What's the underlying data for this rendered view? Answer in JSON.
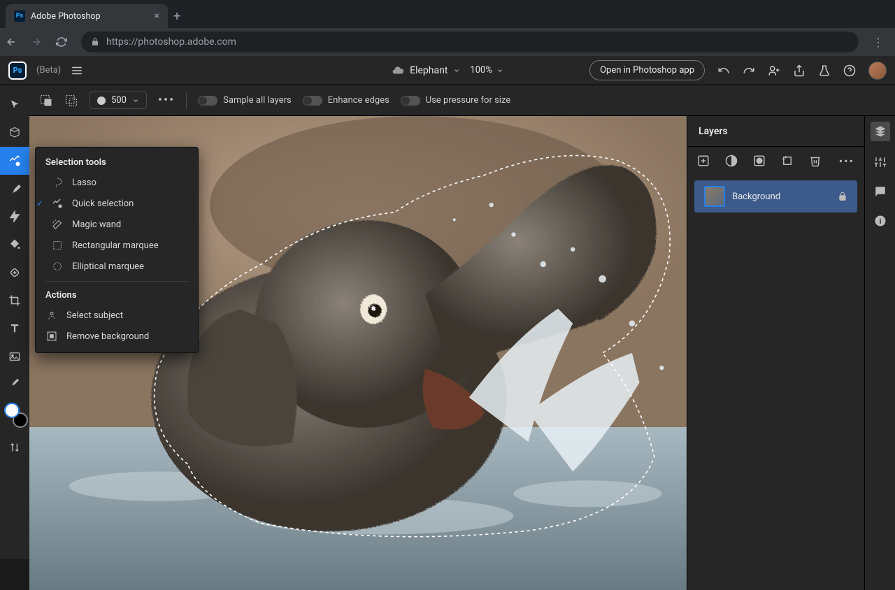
{
  "browser": {
    "tab_title": "Adobe Photoshop",
    "url": "https://photoshop.adobe.com"
  },
  "header": {
    "logo_text": "Ps",
    "beta_label": "(Beta)",
    "doc_name": "Elephant",
    "zoom": "100%",
    "open_app_label": "Open in Photoshop app"
  },
  "options": {
    "brush_size": "500",
    "toggles": [
      {
        "label": "Sample all layers"
      },
      {
        "label": "Enhance edges"
      },
      {
        "label": "Use pressure for size"
      }
    ]
  },
  "flyout": {
    "section1_title": "Selection tools",
    "items": [
      {
        "label": "Lasso",
        "selected": false
      },
      {
        "label": "Quick selection",
        "selected": true
      },
      {
        "label": "Magic wand",
        "selected": false
      },
      {
        "label": "Rectangular marquee",
        "selected": false
      },
      {
        "label": "Elliptical marquee",
        "selected": false
      }
    ],
    "section2_title": "Actions",
    "actions": [
      {
        "label": "Select subject"
      },
      {
        "label": "Remove background"
      }
    ]
  },
  "layers": {
    "panel_title": "Layers",
    "items": [
      {
        "name": "Background",
        "locked": true
      }
    ]
  }
}
